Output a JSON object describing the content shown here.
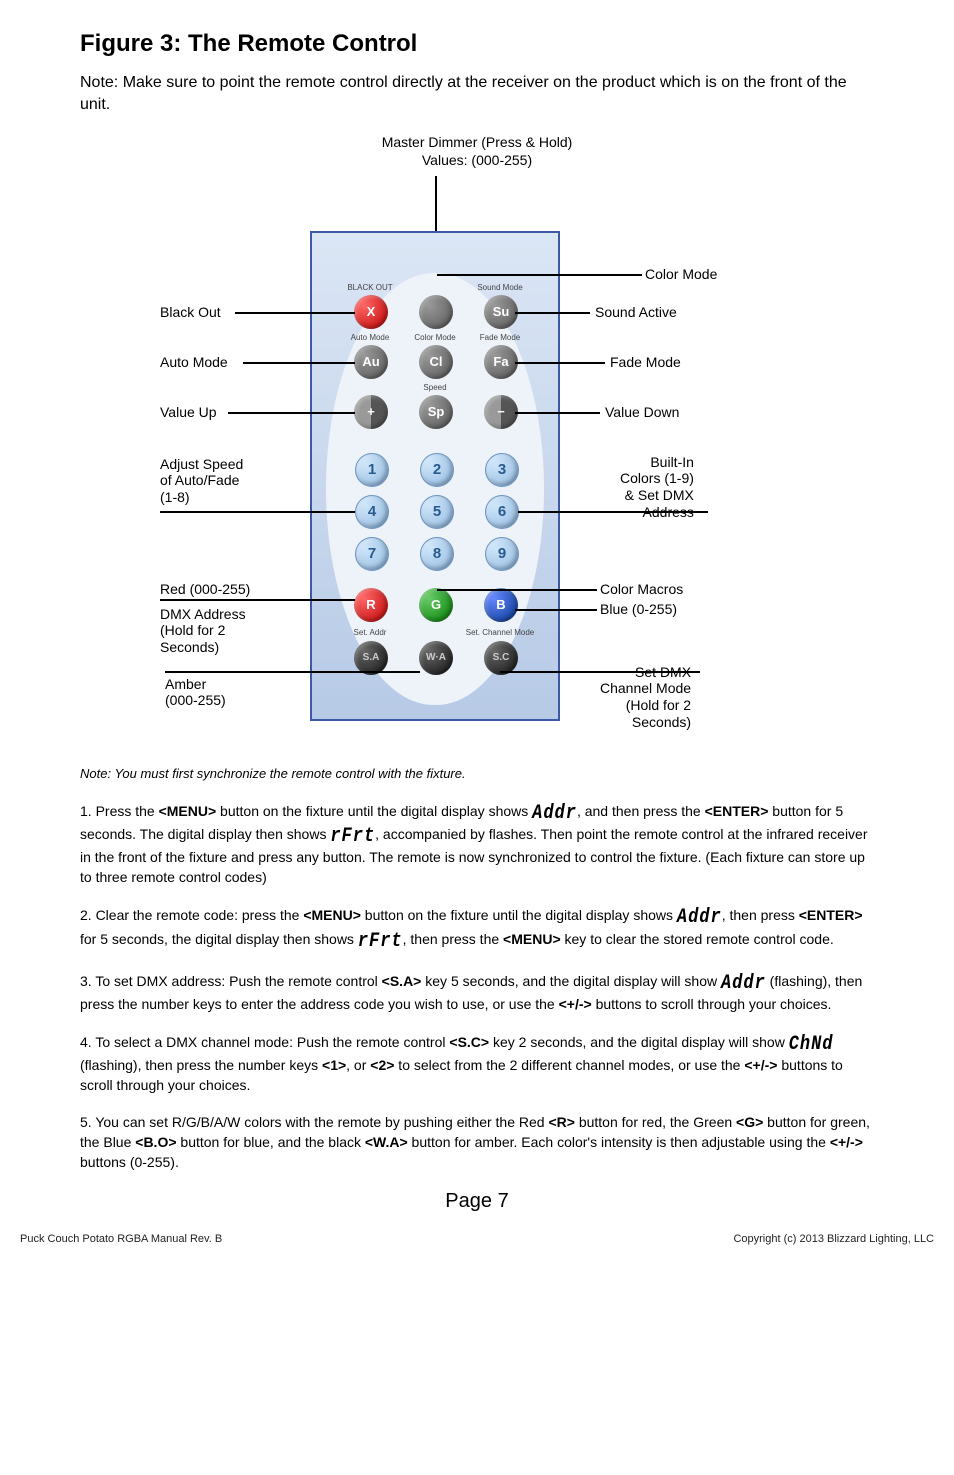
{
  "title": "Figure 3: The Remote Control",
  "intro": "Note: Make sure to point the remote control directly at the receiver on the product which is on the front of the unit.",
  "top_caption_l1": "Master Dimmer (Press & Hold)",
  "top_caption_l2": "Values: (000-255)",
  "labels_left": {
    "black_out": "Black Out",
    "auto_mode": "Auto Mode",
    "value_up": "Value Up",
    "adjust_speed_l1": "Adjust Speed",
    "adjust_speed_l2": "of Auto/Fade",
    "adjust_speed_l3": "(1-8)",
    "red": "Red (000-255)",
    "dmx_addr_l1": "DMX Address",
    "dmx_addr_l2": "(Hold for 2",
    "dmx_addr_l3": "Seconds)",
    "amber_l1": "Amber",
    "amber_l2": "(000-255)"
  },
  "labels_right": {
    "color_mode": "Color Mode",
    "sound_active": "Sound Active",
    "fade_mode": "Fade Mode",
    "value_down": "Value Down",
    "builtin_l1": "Built-In",
    "builtin_l2": "Colors (1-9)",
    "builtin_l3": "& Set DMX",
    "builtin_l4": "Address",
    "color_macros": "Color Macros",
    "blue": "Blue (0-255)",
    "setdmx_l1": "Set DMX",
    "setdmx_l2": "Channel Mode",
    "setdmx_l3": "(Hold for 2",
    "setdmx_l4": "Seconds)"
  },
  "tiny": {
    "black_out": "BLACK OUT",
    "sound_mode": "Sound Mode",
    "auto_mode": "Auto Mode",
    "color_mode": "Color Mode",
    "fade_mode": "Fade Mode",
    "speed": "Speed",
    "set_addr": "Set. Addr",
    "set_ch": "Set. Channel Mode"
  },
  "btns": {
    "x": "X",
    "su": "Su",
    "au": "Au",
    "cl": "Cl",
    "fa": "Fa",
    "plus": "+",
    "sp": "Sp",
    "minus": "−",
    "n1": "1",
    "n2": "2",
    "n3": "3",
    "n4": "4",
    "n5": "5",
    "n6": "6",
    "n7": "7",
    "n8": "8",
    "n9": "9",
    "r": "R",
    "g": "G",
    "b": "B",
    "sa": "S.A",
    "wa": "W·A",
    "sc": "S.C"
  },
  "note_sync": "Note: You must first synchronize the remote control with the fixture.",
  "seg": {
    "addr": "Addr",
    "rfrt": "rFrt",
    "chnd": "ChNd"
  },
  "steps": {
    "s1a": "1. Press the ",
    "s1b": " button on the fixture until the digital display shows ",
    "s1c": ", and then press the ",
    "s1d": " button for 5 seconds. The digital display then shows ",
    "s1e": ", accompanied by flashes. Then point the remote control at the infrared receiver in the front of the fixture and press any button. The remote is now synchronized to control the fixture. (Each fixture can store up to three remote control codes)",
    "s2a": "2. Clear the remote code: press the ",
    "s2b": " button on the fixture until the digital display shows ",
    "s2c": ", then press ",
    "s2d": " for 5 seconds, the digital display then shows ",
    "s2e": ", then press the ",
    "s2f": " key to clear the stored remote control code.",
    "s3a": "3. To set DMX address: Push the remote control ",
    "s3b": " key 5 seconds, and the digital display will show ",
    "s3c": " (flashing), then press the number keys to enter the address code you wish to use, or use the ",
    "s3d": " buttons to scroll through your choices.",
    "s4a": "4. To select a DMX channel mode: Push the remote control ",
    "s4b": " key 2 seconds, and the digital display will show ",
    "s4c": " (flashing), then press the number keys ",
    "s4d": ", or ",
    "s4e": " to select from the 2 different channel modes, or use the ",
    "s4f": " buttons to scroll through your choices.",
    "s5a": "5. You can set R/G/B/A/W colors with the remote by pushing either the Red ",
    "s5b": " button for red, the Green ",
    "s5c": " button for green, the Blue ",
    "s5d": " button for blue, and the black ",
    "s5e": " button for amber. Each color's intensity is then adjustable using the ",
    "s5f": " buttons (0-255)."
  },
  "bold": {
    "menu": "<MENU>",
    "enter": "<ENTER>",
    "sa": "<S.A>",
    "sc": "<S.C>",
    "one": "<1>",
    "two": "<2>",
    "plusminus": "<+/->",
    "r": "<R>",
    "g": "<G>",
    "bo": "<B.O>",
    "wa": "<W.A>"
  },
  "page_num": "Page 7",
  "footer_left": "Puck Couch Potato RGBA Manual Rev. B",
  "footer_right": "Copyright (c) 2013 Blizzard Lighting, LLC"
}
